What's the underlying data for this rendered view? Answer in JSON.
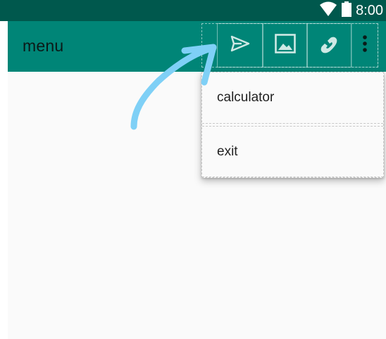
{
  "status_bar": {
    "time": "8:00",
    "wifi_icon": "wifi-icon",
    "battery_icon": "battery-icon",
    "background": "#00584d"
  },
  "app_bar": {
    "title": "menu",
    "background": "#008577",
    "actions": [
      {
        "icon": "send-icon"
      },
      {
        "icon": "image-icon"
      },
      {
        "icon": "phone-icon"
      },
      {
        "icon": "more-vert-icon"
      }
    ]
  },
  "overflow_menu": {
    "items": [
      {
        "label": "calculator"
      },
      {
        "label": "exit"
      }
    ]
  },
  "annotation": {
    "icon": "arrow-annotation-icon",
    "color": "#7fd0f6"
  }
}
